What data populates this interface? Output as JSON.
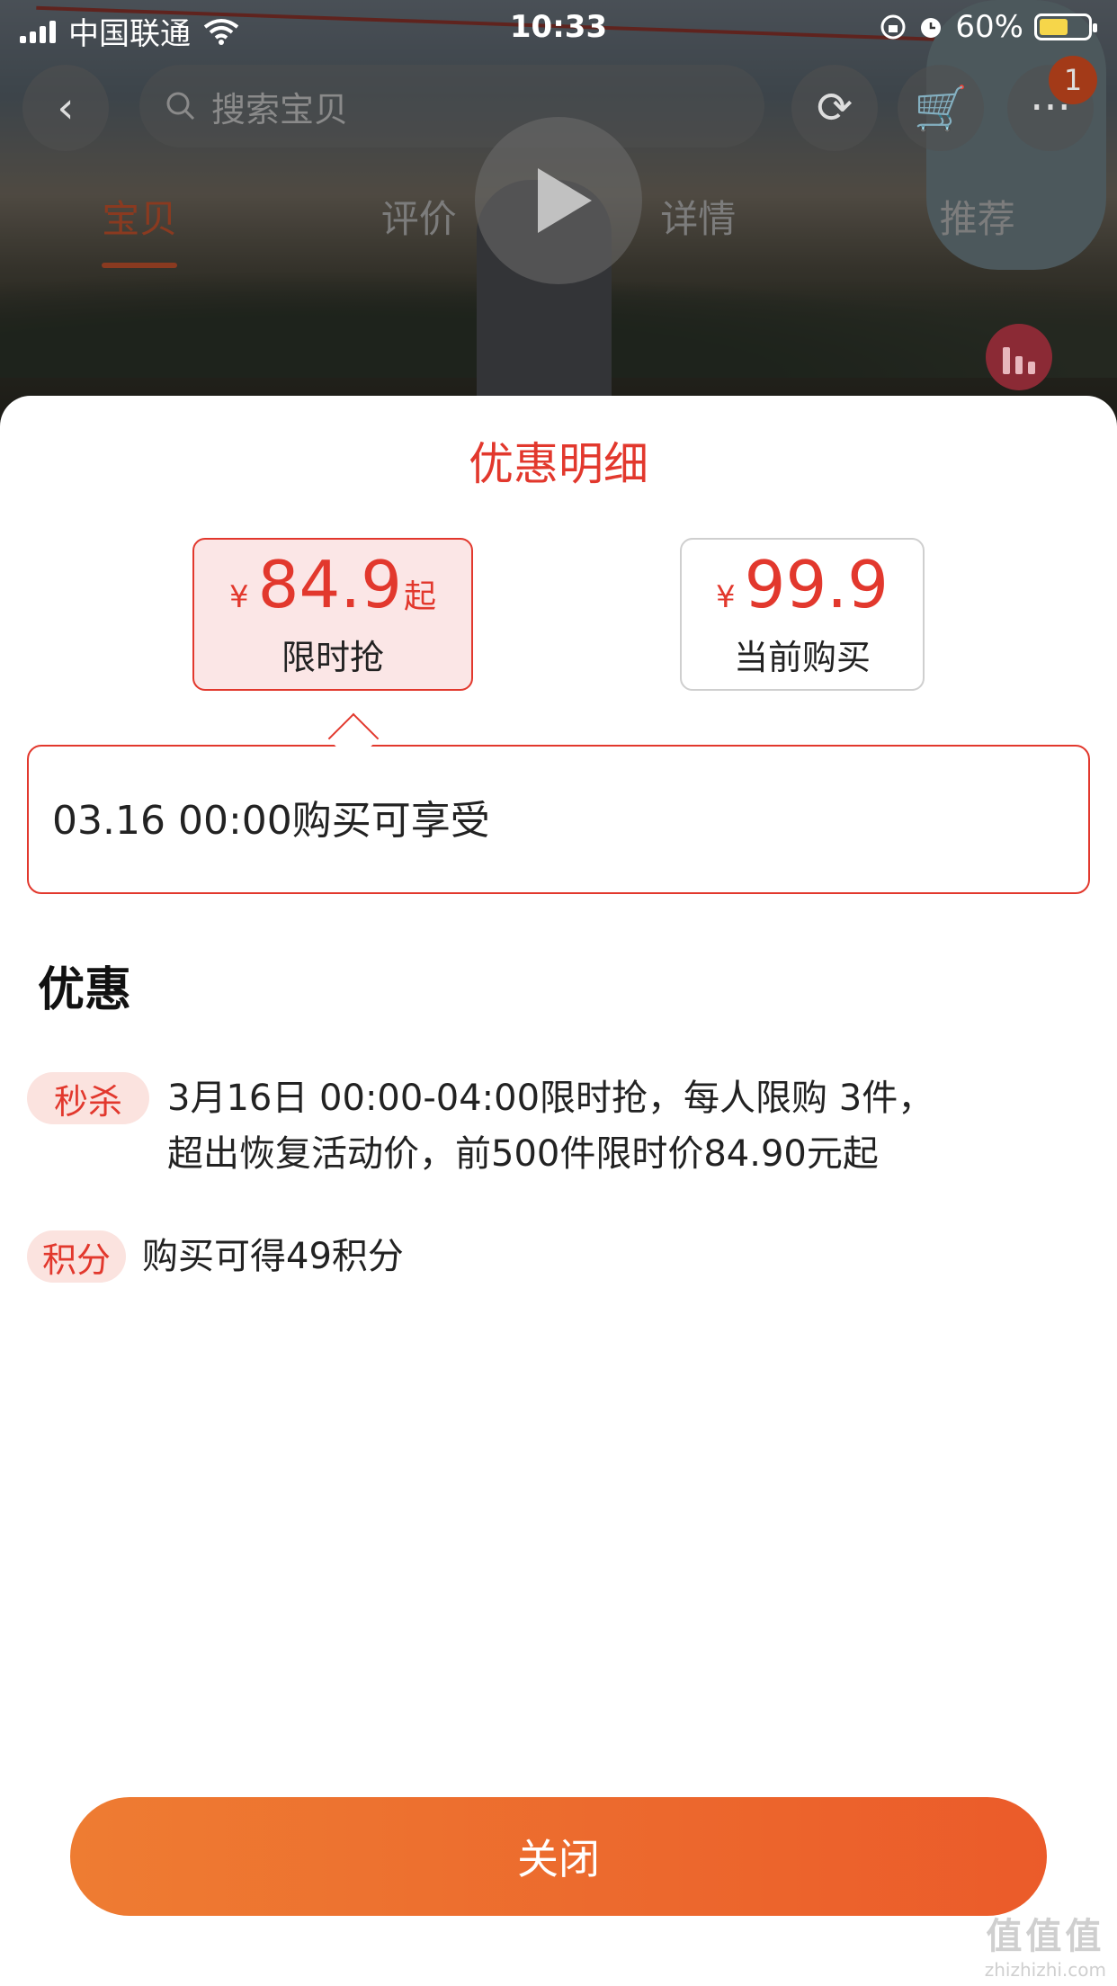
{
  "status_bar": {
    "carrier": "中国联通",
    "time": "10:33",
    "battery": "60%"
  },
  "background": {
    "search_placeholder": "搜索宝贝",
    "cart_badge": "1",
    "tabs": [
      {
        "label": "宝贝"
      },
      {
        "label": "评价"
      },
      {
        "label": "详情"
      },
      {
        "label": "推荐"
      }
    ]
  },
  "sheet": {
    "title": "优惠明细",
    "price_cards": [
      {
        "currency": "¥",
        "price": "84.9",
        "suffix": "起",
        "label": "限时抢"
      },
      {
        "currency": "¥",
        "price": "99.9",
        "label": "当前购买"
      }
    ],
    "callout_text": "03.16 00:00购买可享受",
    "section_title": "优惠",
    "promotions": [
      {
        "tag": "秒杀",
        "line1": "3月16日 00:00-04:00限时抢，每人限购 3件，",
        "line2": "超出恢复活动价，前500件限时价84.90元起"
      },
      {
        "tag": "积分",
        "line1": "购买可得49积分"
      }
    ],
    "close_label": "关闭"
  },
  "watermark": {
    "logo": "值值值",
    "url": "zhizhizhi.com"
  },
  "colors": {
    "accent": "#e2382d",
    "button_start": "#ee7c32",
    "button_end": "#eb5b2a",
    "tag_bg": "#fbe3df"
  }
}
